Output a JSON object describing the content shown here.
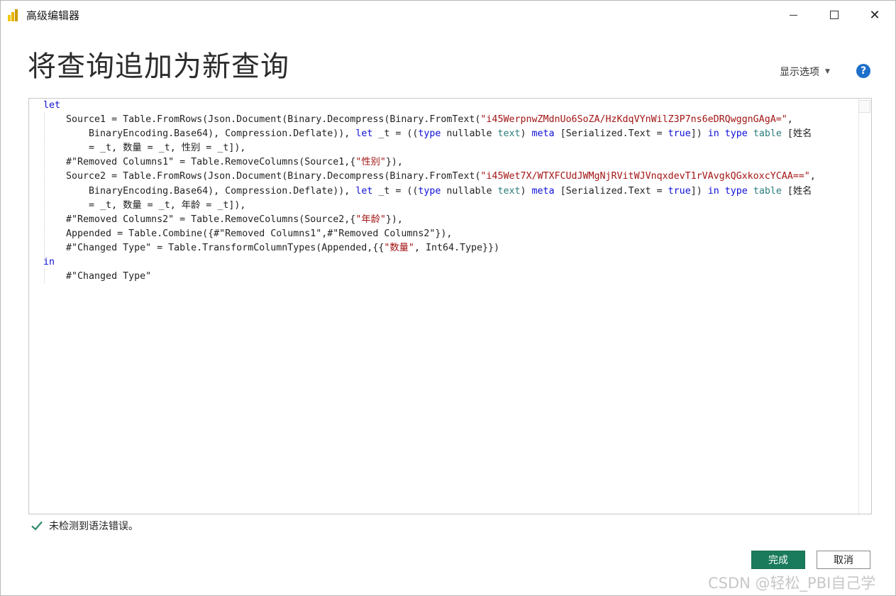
{
  "window": {
    "title": "高级编辑器",
    "controls": {
      "minimize": "minimize-icon",
      "maximize": "maximize-icon",
      "close": "✕"
    }
  },
  "header": {
    "title": "将查询追加为新查询",
    "display_options": "显示选项",
    "help_icon": "?"
  },
  "editor": {
    "lines": [
      [
        {
          "t": "let",
          "c": "kw"
        }
      ],
      [
        {
          "t": "    Source1 = Table.FromRows(Json.Document(Binary.Decompress(Binary.FromText(",
          "c": ""
        },
        {
          "t": "\"i45WerpnwZMdnUo6SoZA/HzKdqVYnWilZ3P7ns6eDRQwggnGAgA=\"",
          "c": "str"
        },
        {
          "t": ",",
          "c": ""
        }
      ],
      [
        {
          "t": "        BinaryEncoding.Base64), Compression.Deflate)), ",
          "c": ""
        },
        {
          "t": "let",
          "c": "kw"
        },
        {
          "t": " _t = ((",
          "c": ""
        },
        {
          "t": "type",
          "c": "kw"
        },
        {
          "t": " nullable ",
          "c": ""
        },
        {
          "t": "text",
          "c": "kt"
        },
        {
          "t": ") ",
          "c": ""
        },
        {
          "t": "meta",
          "c": "kw"
        },
        {
          "t": " [Serialized.Text = ",
          "c": ""
        },
        {
          "t": "true",
          "c": "kw"
        },
        {
          "t": "]) ",
          "c": ""
        },
        {
          "t": "in",
          "c": "kw"
        },
        {
          "t": " ",
          "c": ""
        },
        {
          "t": "type",
          "c": "kw"
        },
        {
          "t": " ",
          "c": ""
        },
        {
          "t": "table",
          "c": "kt"
        },
        {
          "t": " [姓名",
          "c": ""
        }
      ],
      [
        {
          "t": "        = _t, 数量 = _t, 性别 = _t]),",
          "c": ""
        }
      ],
      [
        {
          "t": "    #\"Removed Columns1\" = Table.RemoveColumns(Source1,{",
          "c": ""
        },
        {
          "t": "\"性别\"",
          "c": "str"
        },
        {
          "t": "}),",
          "c": ""
        }
      ],
      [
        {
          "t": "    Source2 = Table.FromRows(Json.Document(Binary.Decompress(Binary.FromText(",
          "c": ""
        },
        {
          "t": "\"i45Wet7X/WTXFCUdJWMgNjRVitWJVnqxdevT1rVAvgkQGxkoxcYCAA==\"",
          "c": "str"
        },
        {
          "t": ",",
          "c": ""
        }
      ],
      [
        {
          "t": "        BinaryEncoding.Base64), Compression.Deflate)), ",
          "c": ""
        },
        {
          "t": "let",
          "c": "kw"
        },
        {
          "t": " _t = ((",
          "c": ""
        },
        {
          "t": "type",
          "c": "kw"
        },
        {
          "t": " nullable ",
          "c": ""
        },
        {
          "t": "text",
          "c": "kt"
        },
        {
          "t": ") ",
          "c": ""
        },
        {
          "t": "meta",
          "c": "kw"
        },
        {
          "t": " [Serialized.Text = ",
          "c": ""
        },
        {
          "t": "true",
          "c": "kw"
        },
        {
          "t": "]) ",
          "c": ""
        },
        {
          "t": "in",
          "c": "kw"
        },
        {
          "t": " ",
          "c": ""
        },
        {
          "t": "type",
          "c": "kw"
        },
        {
          "t": " ",
          "c": ""
        },
        {
          "t": "table",
          "c": "kt"
        },
        {
          "t": " [姓名",
          "c": ""
        }
      ],
      [
        {
          "t": "        = _t, 数量 = _t, 年龄 = _t]),",
          "c": ""
        }
      ],
      [
        {
          "t": "    #\"Removed Columns2\" = Table.RemoveColumns(Source2,{",
          "c": ""
        },
        {
          "t": "\"年龄\"",
          "c": "str"
        },
        {
          "t": "}),",
          "c": ""
        }
      ],
      [
        {
          "t": "    Appended = Table.Combine({#\"Removed Columns1\",#\"Removed Columns2\"}),",
          "c": ""
        }
      ],
      [
        {
          "t": "    #\"Changed Type\" = Table.TransformColumnTypes(Appended,{{",
          "c": ""
        },
        {
          "t": "\"数量\"",
          "c": "str"
        },
        {
          "t": ", Int64.Type}})",
          "c": ""
        }
      ],
      [
        {
          "t": "in",
          "c": "kw"
        }
      ],
      [
        {
          "t": "    #\"Changed Type\"",
          "c": ""
        }
      ]
    ]
  },
  "status": {
    "message": "未检测到语法错误。",
    "icon": "check-icon"
  },
  "buttons": {
    "done": "完成",
    "cancel": "取消"
  },
  "colors": {
    "primary_button": "#197b5b",
    "keyword": "#1010d8",
    "type_keyword": "#2b7c7c",
    "string": "#a31515",
    "help": "#1d6fc9",
    "check": "#2e8b6a"
  },
  "watermark": "CSDN @轻松_PBI自己学"
}
